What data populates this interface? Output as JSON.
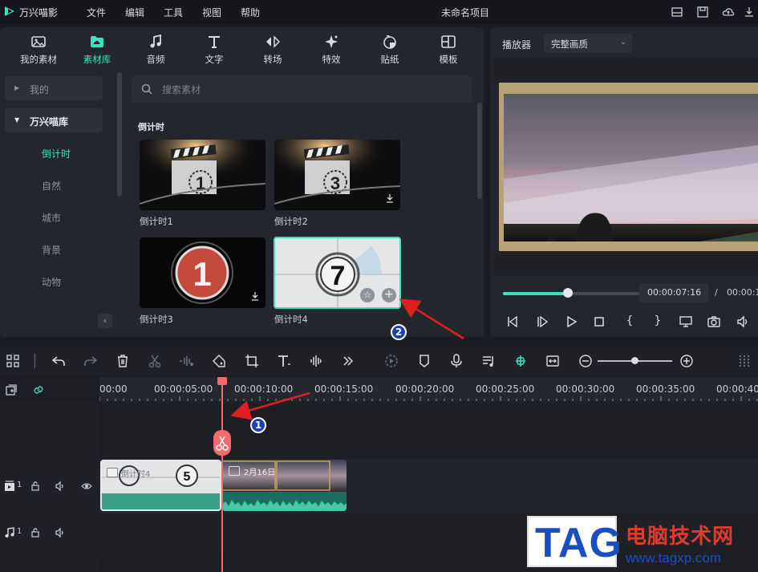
{
  "app": {
    "name": "万兴喵影",
    "project_title": "未命名项目"
  },
  "menu": [
    "文件",
    "编辑",
    "工具",
    "视图",
    "帮助"
  ],
  "tabs": [
    {
      "label": "我的素材",
      "icon": "image-icon"
    },
    {
      "label": "素材库",
      "icon": "cloud-folder-icon",
      "active": true
    },
    {
      "label": "音频",
      "icon": "music-note-icon"
    },
    {
      "label": "文字",
      "icon": "text-icon"
    },
    {
      "label": "转场",
      "icon": "transition-icon"
    },
    {
      "label": "特效",
      "icon": "sparkle-icon"
    },
    {
      "label": "贴纸",
      "icon": "sticker-icon"
    },
    {
      "label": "模板",
      "icon": "template-icon"
    }
  ],
  "sidebar": {
    "items": [
      {
        "label": "我的",
        "expanded": false
      },
      {
        "label": "万兴喵库",
        "expanded": true
      }
    ],
    "sub_items": [
      "倒计时",
      "自然",
      "城市",
      "背景",
      "动物"
    ],
    "active_sub": "倒计时"
  },
  "search": {
    "placeholder": "搜索素材"
  },
  "section_title": "倒计时",
  "cards": [
    {
      "label": "倒计时1",
      "digit": "1"
    },
    {
      "label": "倒计时2",
      "digit": "3"
    },
    {
      "label": "倒计时3",
      "digit": "1"
    },
    {
      "label": "倒计时4",
      "digit": "7"
    }
  ],
  "preview": {
    "label": "播放器",
    "quality": "完整画质",
    "current_time": "00:00:07:16",
    "separator": "/",
    "total_time": "00:00:1",
    "progress": 0.47
  },
  "ruler": {
    "ticks": [
      "00:00",
      "00:00:05:00",
      "00:00:10:00",
      "00:00:15:00",
      "00:00:20:00",
      "00:00:25:00",
      "00:00:30:00",
      "00:00:35:00",
      "00:00:40:"
    ]
  },
  "timeline": {
    "video_track_label": "1",
    "audio_track_label": "1",
    "clip1_label": "倒计时4",
    "clip1_digit": "5",
    "clip2_label": "2月16日",
    "zoom_level": 0.46
  },
  "annotations": {
    "badge1": "1",
    "badge2": "2"
  },
  "watermark": {
    "tag": "TAG",
    "title": "电脑技术网",
    "url": "www.tagxp.com"
  },
  "colors": {
    "accent": "#3ee0bd",
    "playhead": "#f26a6a",
    "annotation_arrow": "#e02020",
    "badge": "#1c3fb8"
  }
}
